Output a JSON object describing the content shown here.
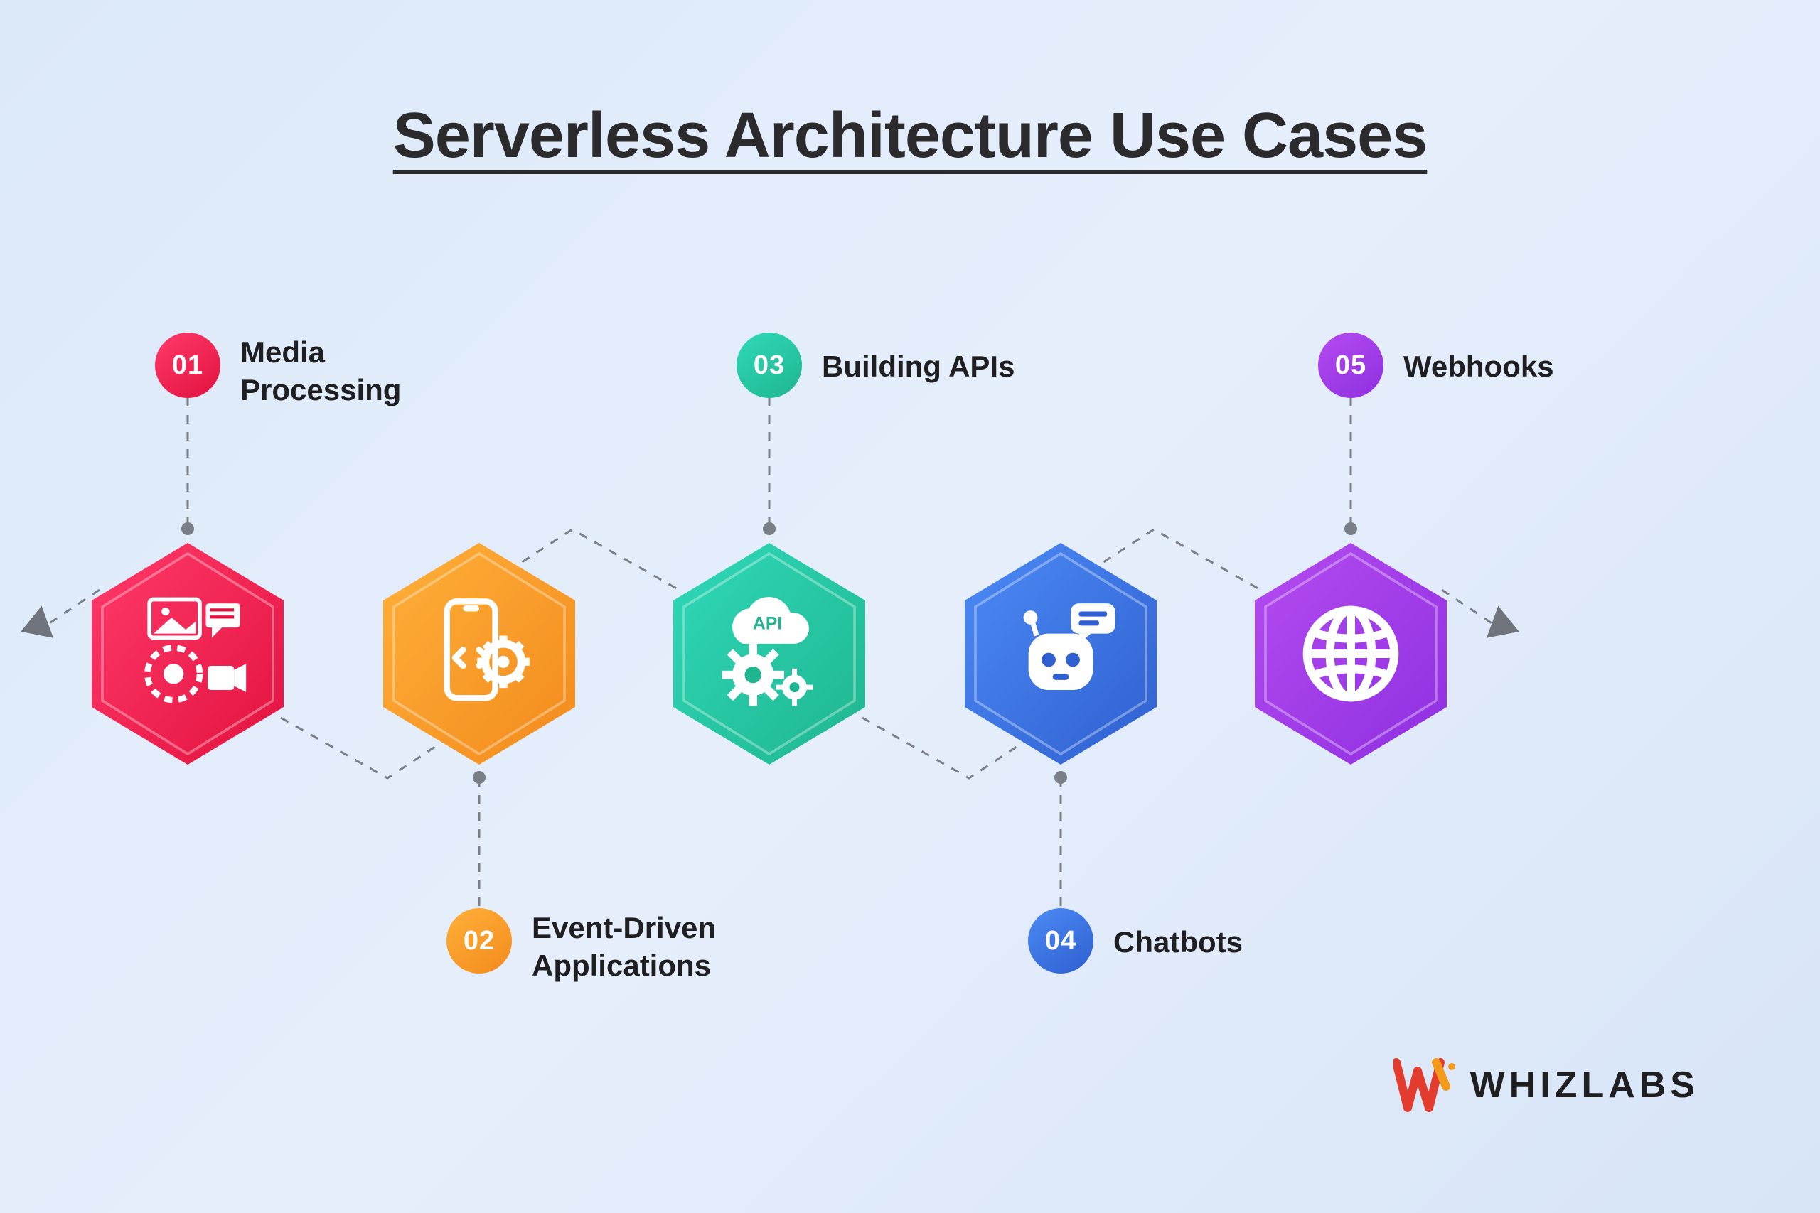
{
  "title": "Serverless Architecture Use Cases",
  "items": [
    {
      "num": "01",
      "label": "Media\nProcessing",
      "color1": "#ff3a6a",
      "color2": "#e2123f",
      "icon": "media"
    },
    {
      "num": "02",
      "label": "Event-Driven\nApplications",
      "color1": "#ffb03a",
      "color2": "#f28a1c",
      "icon": "app"
    },
    {
      "num": "03",
      "label": "Building APIs",
      "color1": "#2fd9b9",
      "color2": "#1fb58f",
      "icon": "api"
    },
    {
      "num": "04",
      "label": "Chatbots",
      "color1": "#4c8bf5",
      "color2": "#2f5fd0",
      "icon": "chatbot"
    },
    {
      "num": "05",
      "label": "Webhooks",
      "color1": "#b44cf0",
      "color2": "#8f2fe0",
      "icon": "globe"
    }
  ],
  "brand": "WHIZLABS"
}
